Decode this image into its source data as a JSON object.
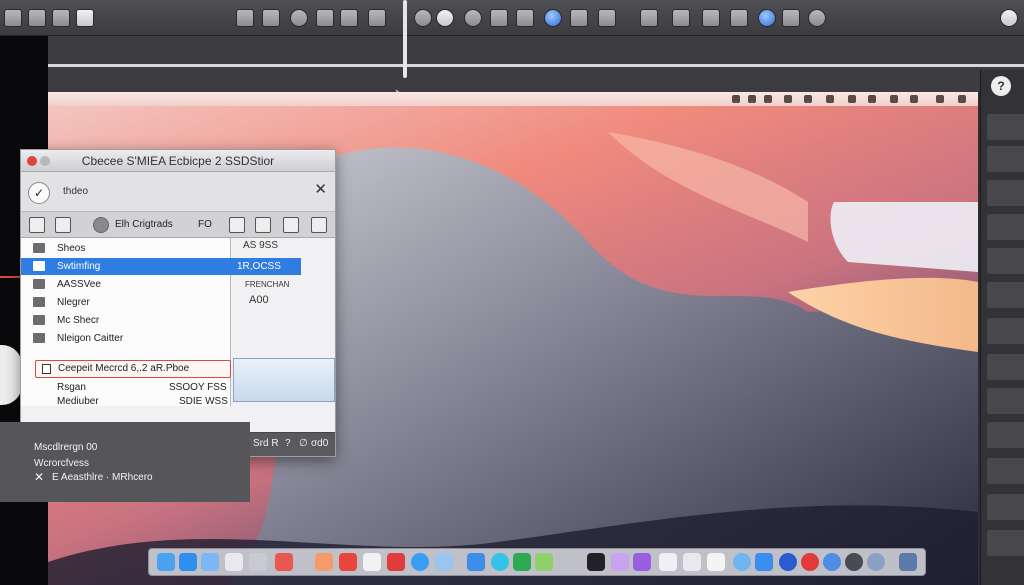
{
  "dialog": {
    "title": "Cbecee S'MIEA Ecbicpe 2 SSDStior",
    "head_name": "thdeo",
    "toolbar_text": "Elh Crigtrads",
    "toolbar_fo": "FO",
    "list_items": [
      {
        "label": "Sheos"
      },
      {
        "label": "Swtimfing",
        "selected": true
      },
      {
        "label": "AASSVee"
      },
      {
        "label": "Nlegrer"
      },
      {
        "label": "Mc Shecr"
      },
      {
        "label": "Nleigon Caitter"
      }
    ],
    "value_top": "AS 9SS",
    "value_selected": "1R,OCSS",
    "value_label": "FRENCHAN",
    "value_big": "A00",
    "highlight_row": "Ceepeit Mecrcd 6,.2 aR.Pboe",
    "sub_rows": [
      {
        "label": "Rsgan",
        "value": "SSOOY FSS"
      },
      {
        "label": "Mediuber",
        "value": "SDIE WSS"
      }
    ],
    "footer": [
      "∅",
      "Srd R",
      "?",
      "∅",
      "σd0"
    ]
  },
  "overlay": {
    "line1": "Mscdlrergn 00",
    "line2": "Wcrorcfvess",
    "line3": "E Aeasthlre · MRhcero"
  },
  "colors": {
    "selection": "#2f7de2",
    "close_button": "#e0443e",
    "highlight_border": "#d74a3e"
  }
}
